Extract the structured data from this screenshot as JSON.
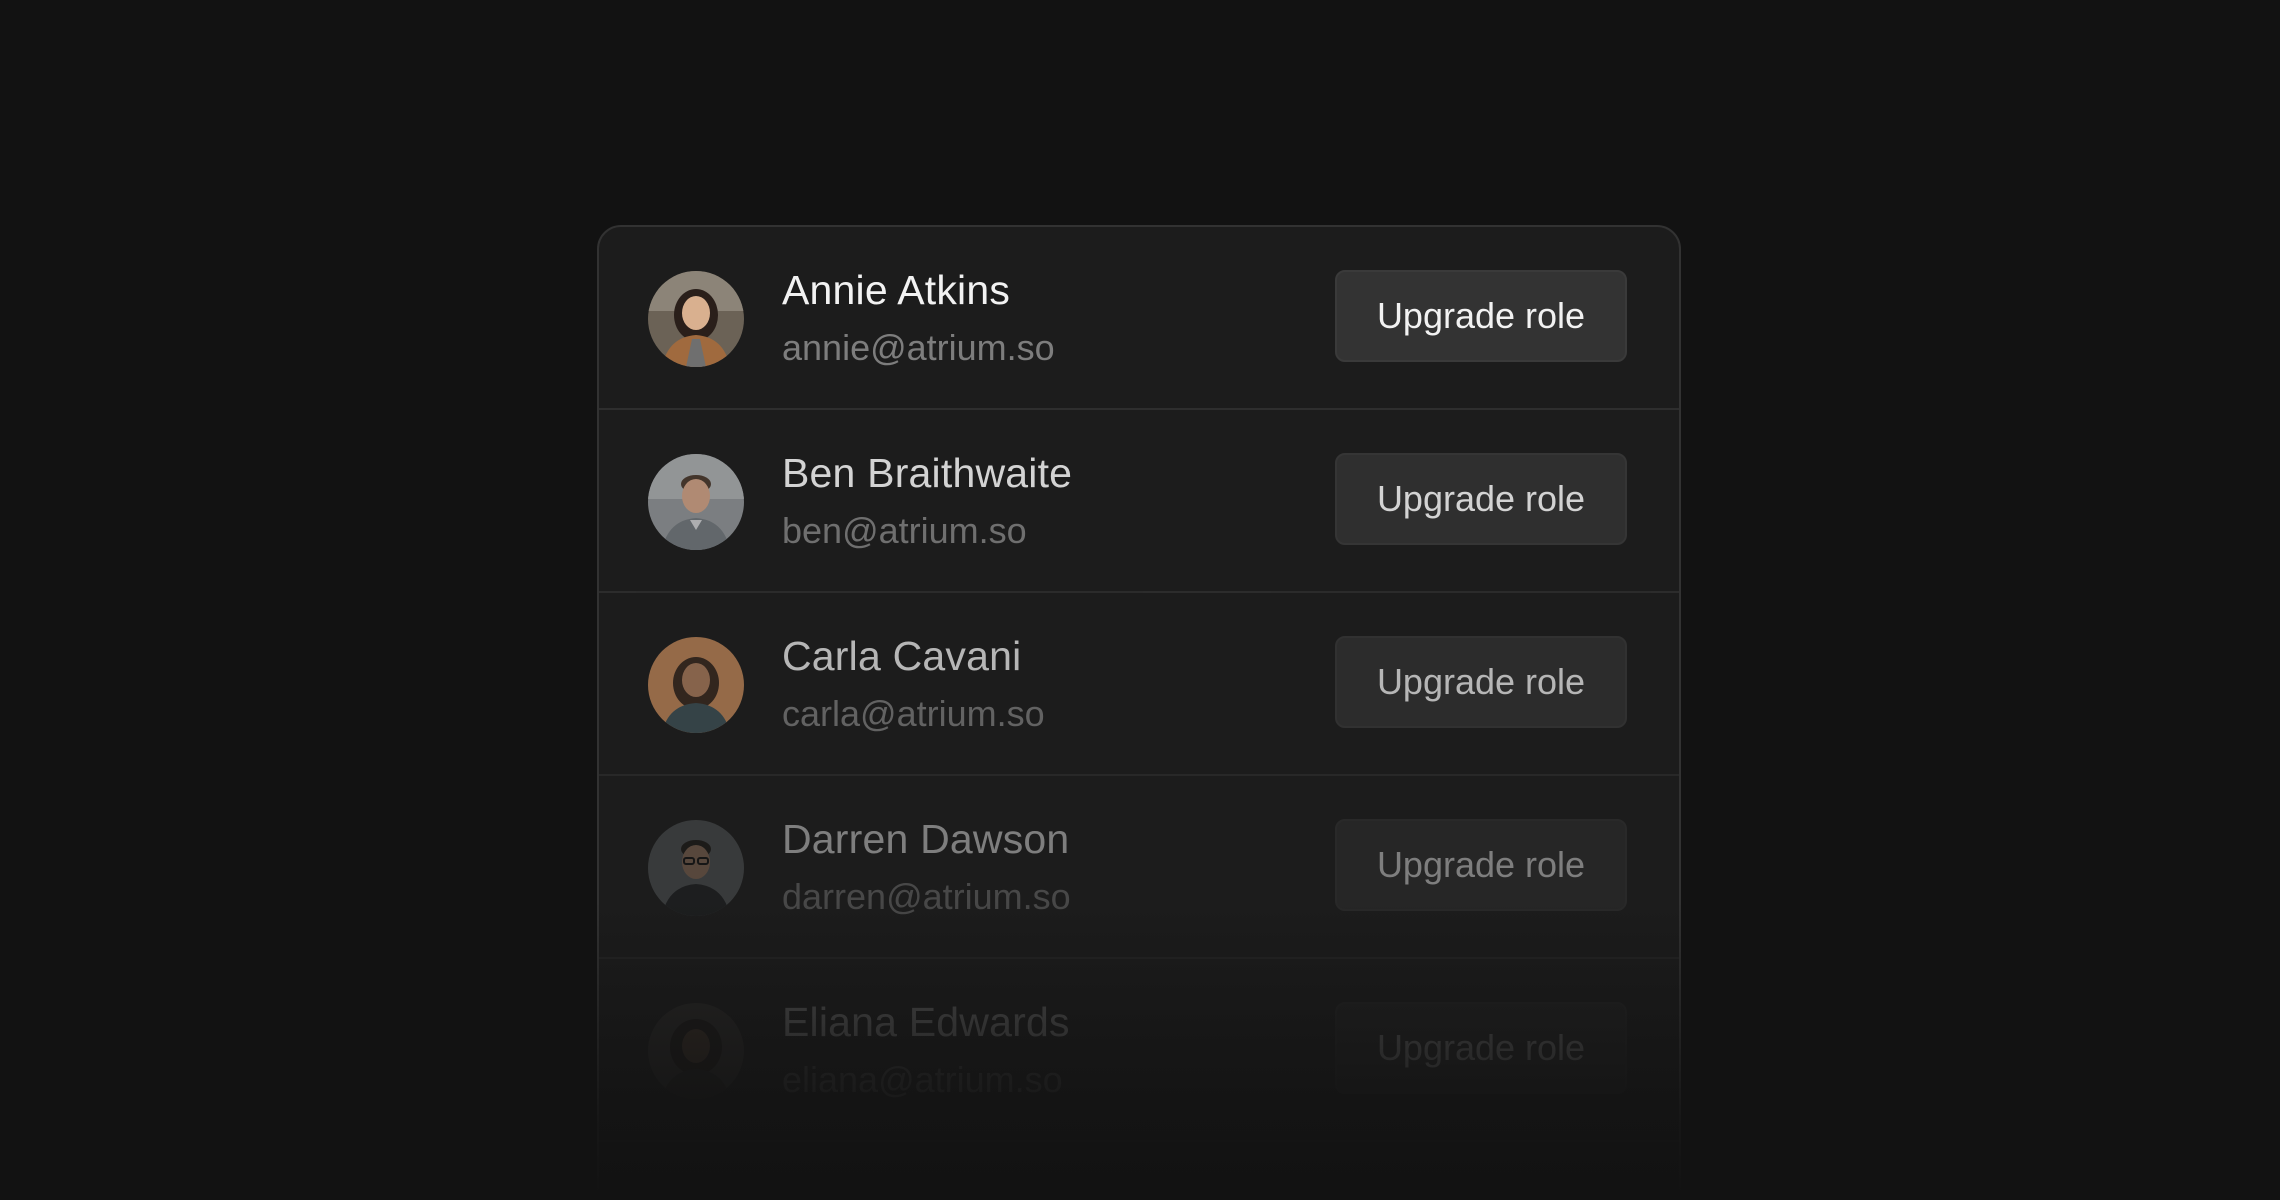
{
  "members": [
    {
      "name": "Annie Atkins",
      "email": "annie@atrium.so",
      "button": "Upgrade role",
      "avatar": "avatar-photo-annie"
    },
    {
      "name": "Ben Braithwaite",
      "email": "ben@atrium.so",
      "button": "Upgrade role",
      "avatar": "avatar-photo-ben"
    },
    {
      "name": "Carla Cavani",
      "email": "carla@atrium.so",
      "button": "Upgrade role",
      "avatar": "avatar-photo-carla"
    },
    {
      "name": "Darren Dawson",
      "email": "darren@atrium.so",
      "button": "Upgrade role",
      "avatar": "avatar-photo-darren"
    },
    {
      "name": "Eliana Edwards",
      "email": "eliana@atrium.so",
      "button": "Upgrade role",
      "avatar": "avatar-photo-eliana"
    }
  ],
  "colors": {
    "background": "#121212",
    "panel": "#1c1c1c",
    "button": "#333333",
    "text_primary": "#f2f2f2",
    "text_secondary": "#7d7d7d"
  }
}
